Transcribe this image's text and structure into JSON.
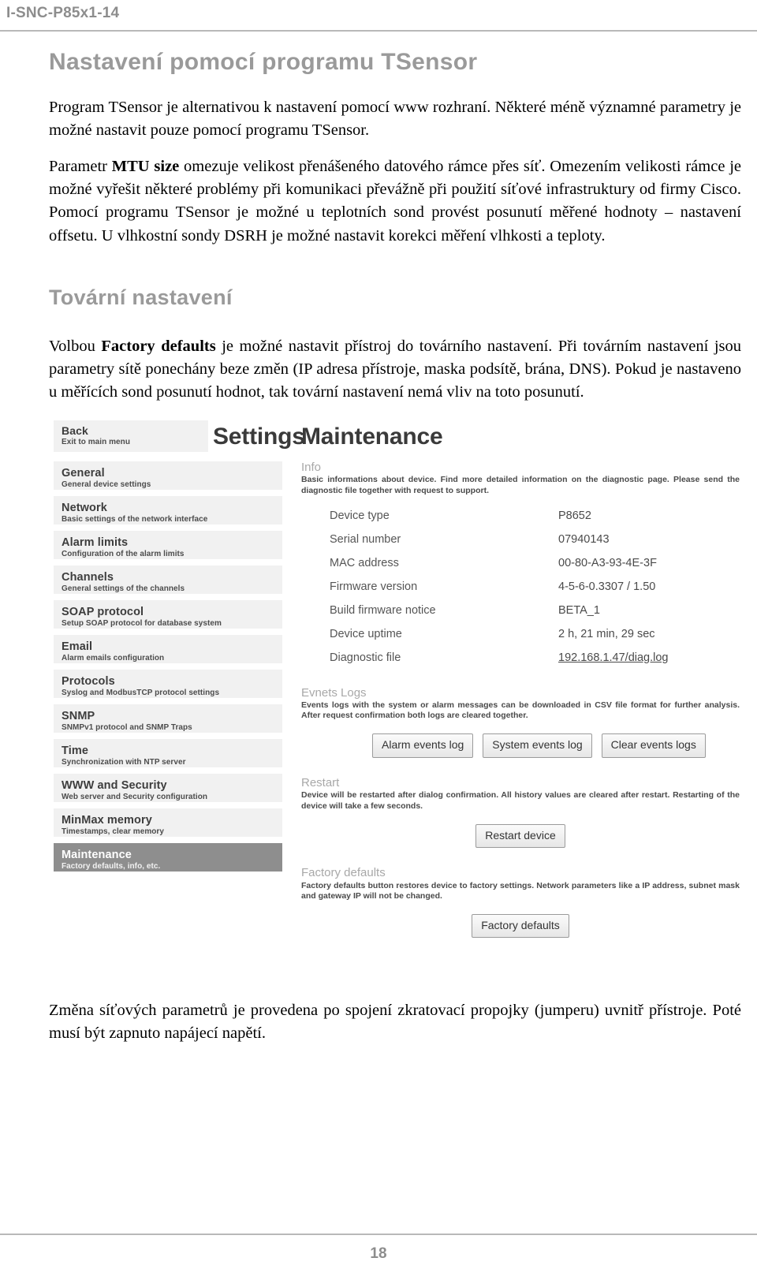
{
  "header": {
    "doc_code": "I-SNC-P85x1-14"
  },
  "footer": {
    "page_number": "18"
  },
  "section1": {
    "heading": "Nastavení pomocí programu TSensor",
    "para1": "Program TSensor je alternativou k nastavení pomocí www rozhraní. Některé méně významné parametry je možné nastavit pouze pomocí programu TSensor.",
    "para2_pre": "Parametr ",
    "para2_bold": "MTU size",
    "para2_post": " omezuje velikost přenášeného datového rámce přes síť. Omezením velikosti rámce je možné vyřešit některé problémy při komunikaci převážně při použití síťové infrastruktury od firmy Cisco. Pomocí programu TSensor je možné u teplotních sond provést posunutí měřené hodnoty – nastavení offsetu. U vlhkostní sondy DSRH je možné nastavit korekci měření vlhkosti a teploty."
  },
  "section2": {
    "heading": "Tovární nastavení",
    "para1_pre": "Volbou ",
    "para1_bold": "Factory defaults",
    "para1_post": " je možné nastavit přístroj do továrního nastavení. Při továrním nastavení jsou parametry sítě ponechány beze změn (IP adresa přístroje, maska podsítě, brána, DNS). Pokud je nastaveno u měřících sond posunutí hodnot, tak tovární nastavení nemá vliv na toto posunutí.",
    "para2": "Změna síťových parametrů je provedena po spojení zkratovací propojky (jumperu) uvnitř přístroje. Poté musí být zapnuto napájecí napětí."
  },
  "screenshot": {
    "settings_word": "Settings",
    "pane_title": "Maintenance",
    "back": {
      "title": "Back",
      "subtitle": "Exit to main menu"
    },
    "nav_items": [
      {
        "title": "General",
        "subtitle": "General device settings",
        "active": false
      },
      {
        "title": "Network",
        "subtitle": "Basic settings of the network interface",
        "active": false
      },
      {
        "title": "Alarm limits",
        "subtitle": "Configuration of the alarm limits",
        "active": false
      },
      {
        "title": "Channels",
        "subtitle": "General settings of the channels",
        "active": false
      },
      {
        "title": "SOAP protocol",
        "subtitle": "Setup SOAP protocol for database system",
        "active": false
      },
      {
        "title": "Email",
        "subtitle": "Alarm emails configuration",
        "active": false
      },
      {
        "title": "Protocols",
        "subtitle": "Syslog and ModbusTCP protocol settings",
        "active": false
      },
      {
        "title": "SNMP",
        "subtitle": "SNMPv1 protocol and SNMP Traps",
        "active": false
      },
      {
        "title": "Time",
        "subtitle": "Synchronization with NTP server",
        "active": false
      },
      {
        "title": "WWW and Security",
        "subtitle": "Web server and Security configuration",
        "active": false
      },
      {
        "title": "MinMax memory",
        "subtitle": "Timestamps, clear memory",
        "active": false
      },
      {
        "title": "Maintenance",
        "subtitle": "Factory defaults, info, etc.",
        "active": true
      }
    ],
    "info": {
      "group_title": "Info",
      "group_desc": "Basic informations about device. Find more detailed information on the diagnostic page. Please send the diagnostic file together with request to support.",
      "rows": [
        {
          "key": "Device type",
          "value": "P8652"
        },
        {
          "key": "Serial number",
          "value": "07940143"
        },
        {
          "key": "MAC address",
          "value": "00-80-A3-93-4E-3F"
        },
        {
          "key": "Firmware version",
          "value": "4-5-6-0.3307 / 1.50"
        },
        {
          "key": "Build firmware notice",
          "value": "BETA_1"
        },
        {
          "key": "Device uptime",
          "value": "2 h, 21 min, 29 sec"
        },
        {
          "key": "Diagnostic file",
          "value": "192.168.1.47/diag.log"
        }
      ]
    },
    "events": {
      "group_title": "Evnets Logs",
      "group_desc": "Events logs with the system or alarm messages can be downloaded in CSV file format for further analysis. After request confirmation both logs are cleared together.",
      "buttons": [
        "Alarm events log",
        "System events log",
        "Clear events logs"
      ]
    },
    "restart": {
      "group_title": "Restart",
      "group_desc": "Device will be restarted after dialog confirmation. All history values are cleared after restart. Restarting of the device will take a few seconds.",
      "button": "Restart device"
    },
    "factory": {
      "group_title": "Factory defaults",
      "group_desc": "Factory defaults button restores device to factory settings. Network parameters like a IP address, subnet mask and gateway IP will not be changed.",
      "button": "Factory defaults"
    }
  }
}
